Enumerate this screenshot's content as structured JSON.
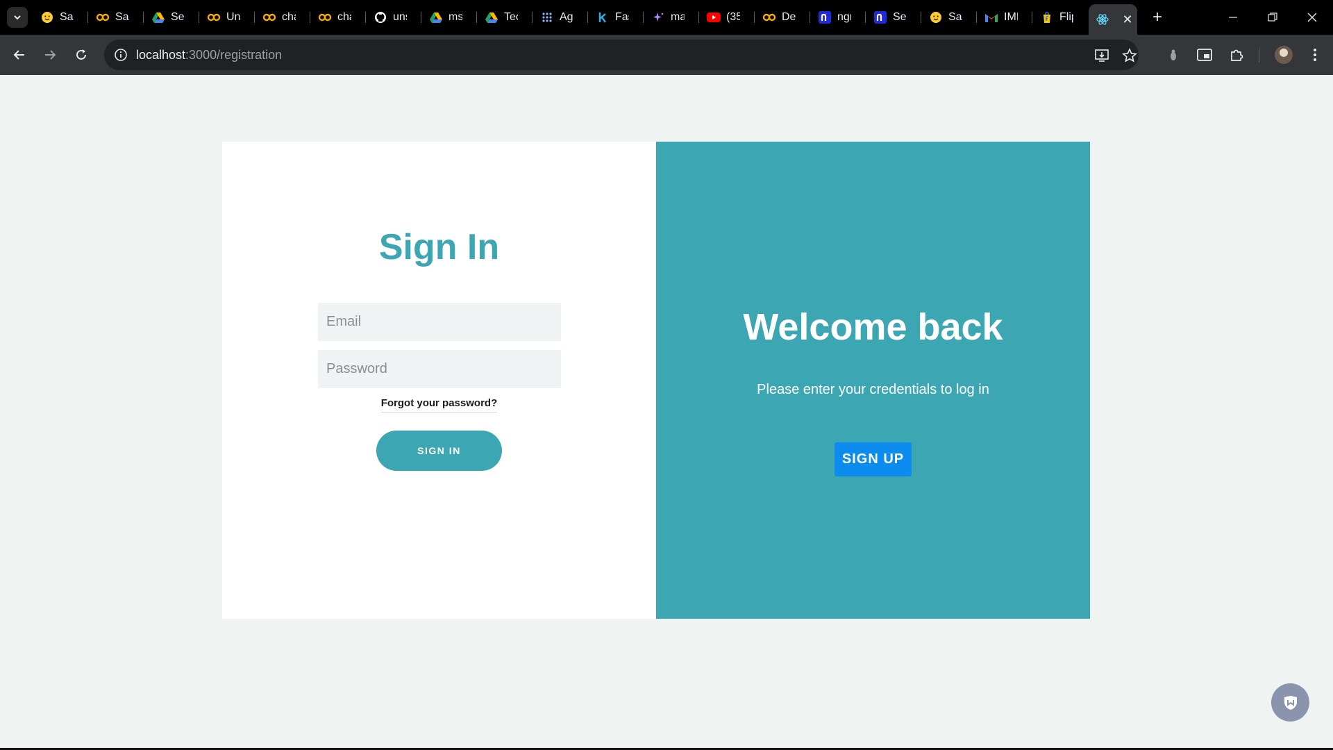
{
  "tabs": [
    {
      "title": "Sat",
      "icon": "hugging-face-icon",
      "color": "#ffcc33"
    },
    {
      "title": "Sar",
      "icon": "colab-icon",
      "color": "#f9ab00"
    },
    {
      "title": "Sea",
      "icon": "google-drive-icon",
      "color": "#1fa463"
    },
    {
      "title": "Unt",
      "icon": "colab-icon",
      "color": "#f9ab00"
    },
    {
      "title": "cha",
      "icon": "colab-icon",
      "color": "#f9ab00"
    },
    {
      "title": "cha",
      "icon": "colab-icon",
      "color": "#f9ab00"
    },
    {
      "title": "uns",
      "icon": "github-icon",
      "color": "#ffffff"
    },
    {
      "title": "ms",
      "icon": "google-drive-icon",
      "color": "#1fa463"
    },
    {
      "title": "Tec",
      "icon": "google-drive-icon",
      "color": "#1fa463"
    },
    {
      "title": "Ag",
      "icon": "apps-grid-icon",
      "color": "#8ab4f8"
    },
    {
      "title": "Fas",
      "icon": "k-letter-icon",
      "color": "#20b2e8"
    },
    {
      "title": "ma",
      "icon": "sparkle-icon",
      "color": "#a78bfa"
    },
    {
      "title": "(35",
      "icon": "youtube-icon",
      "color": "#ff0000"
    },
    {
      "title": "De",
      "icon": "colab-icon",
      "color": "#f9ab00"
    },
    {
      "title": "ngr",
      "icon": "ngrok-icon",
      "color": "#1f2bd6"
    },
    {
      "title": "Set",
      "icon": "ngrok-icon",
      "color": "#1f2bd6"
    },
    {
      "title": "Sat",
      "icon": "hugging-face-icon",
      "color": "#ffcc33"
    },
    {
      "title": "IMI",
      "icon": "gmail-icon",
      "color": "#ea4335"
    },
    {
      "title": "Flip",
      "icon": "flipkart-icon",
      "color": "#f6c300"
    }
  ],
  "active_tab": {
    "icon": "react-icon",
    "color": "#61dafb",
    "close": "✕"
  },
  "new_tab": "+",
  "address": {
    "host": "localhost",
    "path": ":3000/registration"
  },
  "signin": {
    "title": "Sign In",
    "email_placeholder": "Email",
    "password_placeholder": "Password",
    "forgot": "Forgot your password?",
    "button": "SIGN IN"
  },
  "welcome": {
    "title": "Welcome back",
    "subtitle": "Please enter your credentials to log in",
    "button": "SIGN UP"
  },
  "colors": {
    "accent": "#3ca7b2",
    "signup": "#0d8cf0",
    "page_bg": "#eff3f2"
  }
}
